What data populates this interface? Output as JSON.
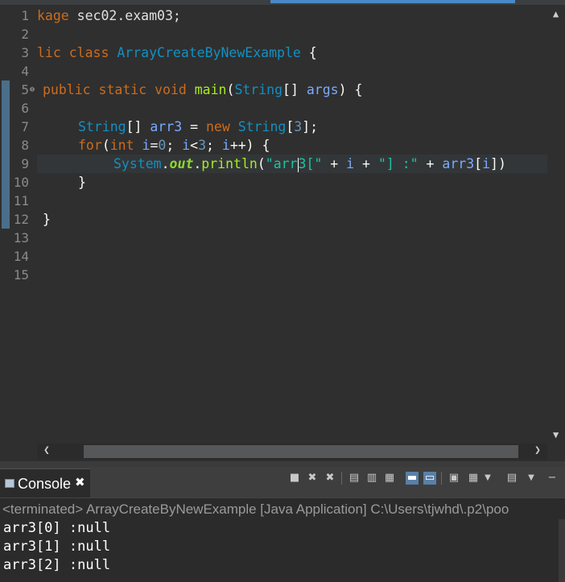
{
  "editor": {
    "line_numbers": [
      "1",
      "2",
      "3",
      "4",
      "5",
      "6",
      "7",
      "8",
      "9",
      "10",
      "11",
      "12",
      "13",
      "14",
      "15"
    ],
    "fold_marker": "⊖",
    "code": {
      "l1_kw": "kage",
      "l1_rest": " sec02.exam03;",
      "l3_kw": "lic class",
      "l3_cls": "ArrayCreateByNewExample",
      "l3_rest": " {",
      "l5_kw": "public static void",
      "l5_mth": "main",
      "l5_p1": "(",
      "l5_cls": "String",
      "l5_p2": "[] ",
      "l5_var": "args",
      "l5_p3": ") {",
      "l7_cls": "String",
      "l7_p1": "[] ",
      "l7_var": "arr3",
      "l7_p2": " = ",
      "l7_kw": "new",
      "l7_cls2": "String",
      "l7_p3": "[",
      "l7_num": "3",
      "l7_p4": "];",
      "l8_kw": "for",
      "l8_p1": "(",
      "l8_kw2": "int",
      "l8_var": "i",
      "l8_p2": "=",
      "l8_num": "0",
      "l8_p3": "; ",
      "l8_var2": "i",
      "l8_p4": "<",
      "l8_num2": "3",
      "l8_p5": "; ",
      "l8_var3": "i",
      "l8_p6": "++) {",
      "l9_cls": "System",
      "l9_p1": ".",
      "l9_fld": "out",
      "l9_p2": ".",
      "l9_mth": "println",
      "l9_p3": "(",
      "l9_str1": "\"arr",
      "l9_str2": "3[\"",
      "l9_p4": " + ",
      "l9_var": "i",
      "l9_p5": " + ",
      "l9_str3": "\"] :\"",
      "l9_p6": " + ",
      "l9_var2": "arr3",
      "l9_p7": "[",
      "l9_var3": "i",
      "l9_p8": "])",
      "l10": "}",
      "l12": "}"
    },
    "scroll": {
      "up": "▲",
      "down": "▼",
      "left": "❮",
      "right": "❯"
    }
  },
  "console": {
    "tab_label": "Console",
    "tab_close": "✖",
    "status": "<terminated> ArrayCreateByNewExample [Java Application] C:\\Users\\tjwhd\\.p2\\poo",
    "output": [
      "arr3[0] :null",
      "arr3[1] :null",
      "arr3[2] :null"
    ],
    "toolbar": {
      "terminate": "■",
      "remove": "✖",
      "remove_all": "✖",
      "clear": "▤",
      "scroll_lock": "▥",
      "word_wrap": "▦",
      "show_out": "▬",
      "show_err": "▭",
      "pin": "▣",
      "display": "▦",
      "display_menu": "▼",
      "open": "▤",
      "open_menu": "▼",
      "minimize": "−"
    }
  }
}
